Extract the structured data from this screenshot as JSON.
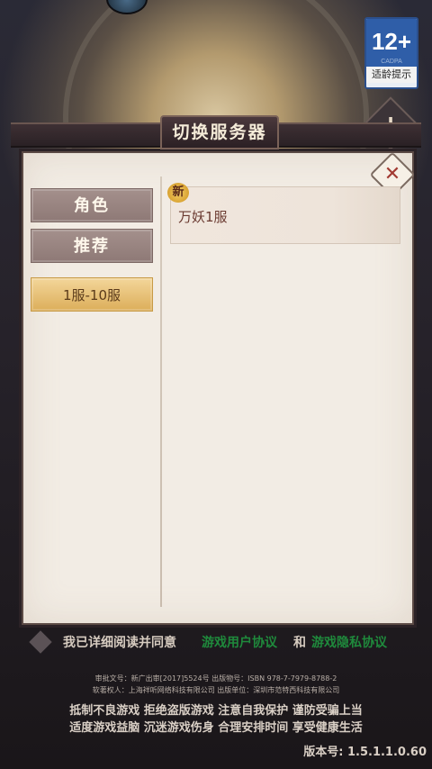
{
  "top": {
    "age_rating": "12+",
    "age_org": "CADPA",
    "age_tip": "适龄提示",
    "notice_icon": "!"
  },
  "dialog": {
    "title": "切换服务器",
    "close_icon": "✕",
    "side_tabs": [
      {
        "label": "角色"
      },
      {
        "label": "推荐"
      },
      {
        "label": "1服-10服"
      }
    ],
    "servers": [
      {
        "name": "万妖1服",
        "badge": "新"
      }
    ]
  },
  "agreement": {
    "prefix": "我已详细阅读并同意",
    "user_agreement": "游戏用户协议",
    "and": "和",
    "privacy": "游戏隐私协议"
  },
  "registration": {
    "line1": "审批文号：新广出审[2017]5524号  出版物号：ISBN 978-7-7979-8788-2",
    "line2": "软著权人：上海祥听网络科技有限公司  出版单位：深圳市范特西科技有限公司"
  },
  "health_notice": {
    "line1": "抵制不良游戏  拒绝盗版游戏  注意自我保护  谨防受骗上当",
    "line2": "适度游戏益脑  沉迷游戏伤身  合理安排时间  享受健康生活"
  },
  "version": "版本号: 1.5.1.1.0.60",
  "colors": {
    "selected_tab": "#dcae5a",
    "link": "#1f8a3c",
    "title_bar": "#2b2024"
  }
}
